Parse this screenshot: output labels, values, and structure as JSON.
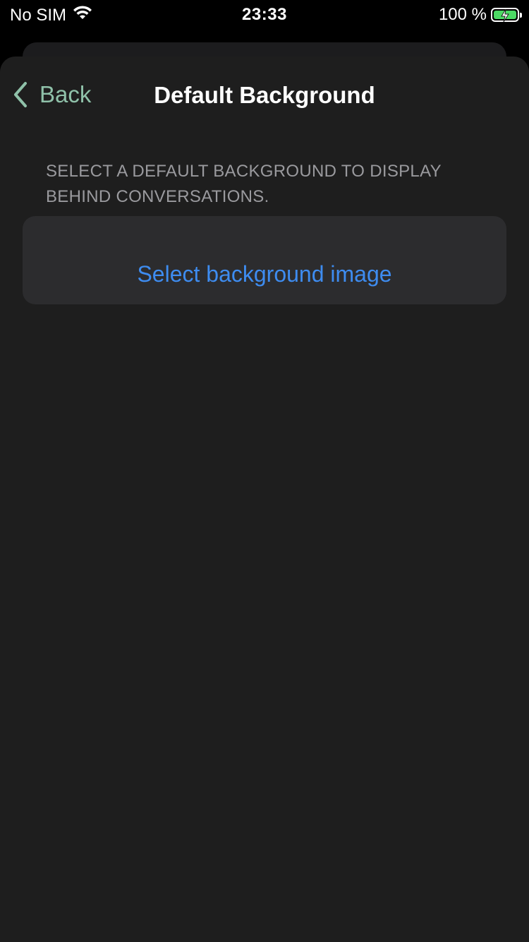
{
  "status_bar": {
    "carrier": "No SIM",
    "time": "23:33",
    "battery_percent": "100 %",
    "battery_level": 1.0,
    "battery_color": "#4cd964",
    "wifi_icon": "wifi-icon",
    "battery_icon": "battery-charging-icon"
  },
  "nav": {
    "back_label": "Back",
    "back_icon": "chevron-left-icon",
    "title": "Default Background"
  },
  "section": {
    "header": "SELECT A DEFAULT BACKGROUND TO DISPLAY BEHIND CONVERSATIONS.",
    "action_label": "Select background image"
  },
  "colors": {
    "accent_back": "#8fc1a9",
    "link_blue": "#3e8cf0",
    "sheet_bg": "#1e1e1e",
    "cell_bg": "#2c2c2e"
  }
}
